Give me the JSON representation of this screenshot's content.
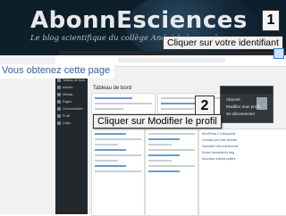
{
  "banner": {
    "logo_text": "AbonnEsciences",
    "tagline": "Le blog scientifique du collège André Lahemonde"
  },
  "steps": {
    "step1": {
      "number": "1",
      "text": "Cliquer sur votre identifiant"
    },
    "step2": {
      "number": "2",
      "text": "Cliquer sur Modifier le profil"
    },
    "intro": "Vous obtenez cette page"
  },
  "wp_admin": {
    "page_title": "Tableau de bord",
    "sidebar_items": [
      "Tableau de bord",
      "Articles",
      "Médias",
      "Pages",
      "Commentaires",
      "Profil",
      "Outils"
    ],
    "dropdown_items": [
      "Abonné",
      "Modifier mon profil",
      "Se déconnecter"
    ],
    "news_lines": [
      "WordPress 4.3 disponible",
      "Conseils pour bien débuter",
      "Calendrier des événements",
      "Suivez l'actualité du blog",
      "Nouveaux articles publiés"
    ]
  },
  "colors": {
    "banner_bg": "#0e1f2c",
    "accent_blue": "#2f5ea8",
    "wp_dark": "#23282d"
  }
}
